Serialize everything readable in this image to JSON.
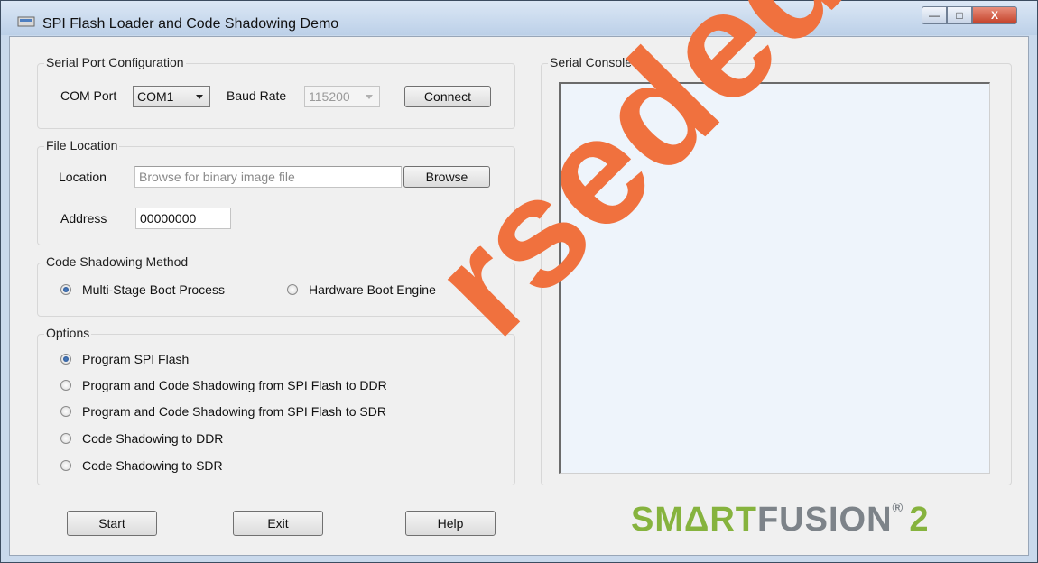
{
  "window": {
    "title": "SPI Flash Loader and Code Shadowing Demo",
    "controls": {
      "minimize": "—",
      "maximize": "□",
      "close": "X"
    }
  },
  "serial_port": {
    "group_label": "Serial Port Configuration",
    "com_port_label": "COM Port",
    "com_port_value": "COM1",
    "baud_rate_label": "Baud Rate",
    "baud_rate_value": "115200",
    "connect_label": "Connect"
  },
  "file_location": {
    "group_label": "File Location",
    "location_label": "Location",
    "location_placeholder": "Browse for binary image file",
    "browse_label": "Browse",
    "address_label": "Address",
    "address_value": "00000000"
  },
  "shadowing_method": {
    "group_label": "Code Shadowing Method",
    "options": [
      {
        "label": "Multi-Stage Boot Process",
        "selected": true
      },
      {
        "label": "Hardware Boot Engine",
        "selected": false
      }
    ]
  },
  "options": {
    "group_label": "Options",
    "items": [
      {
        "label": "Program SPI Flash",
        "selected": true
      },
      {
        "label": "Program and Code Shadowing from SPI Flash to DDR",
        "selected": false
      },
      {
        "label": "Program and Code Shadowing from SPI Flash to SDR",
        "selected": false
      },
      {
        "label": "Code Shadowing to DDR",
        "selected": false
      },
      {
        "label": "Code Shadowing to SDR",
        "selected": false
      }
    ]
  },
  "console": {
    "group_label": "Serial Console"
  },
  "buttons": {
    "start": "Start",
    "exit": "Exit",
    "help": "Help"
  },
  "logo": {
    "smart": "SMΔRT",
    "fusion": "FUSION",
    "reg": "®",
    "two": "2"
  },
  "watermark": {
    "text": "rseded",
    "color": "#f0713e"
  }
}
